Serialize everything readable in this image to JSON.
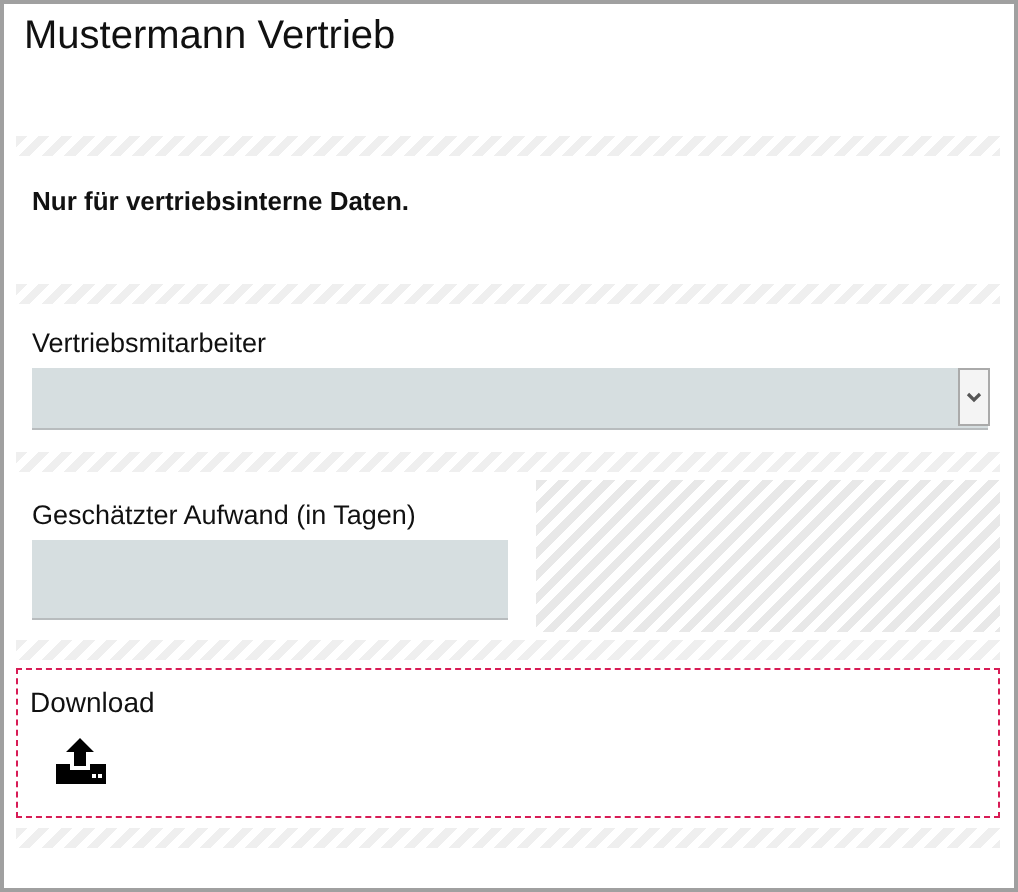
{
  "title": "Mustermann Vertrieb",
  "note": "Nur für vertriebsinterne Daten.",
  "fields": [
    {
      "kind": "select",
      "label": "Vertriebsmitarbeiter"
    },
    {
      "kind": "text",
      "label": "Geschätzter Aufwand (in Tagen)"
    }
  ],
  "upload": {
    "label": "Download"
  }
}
